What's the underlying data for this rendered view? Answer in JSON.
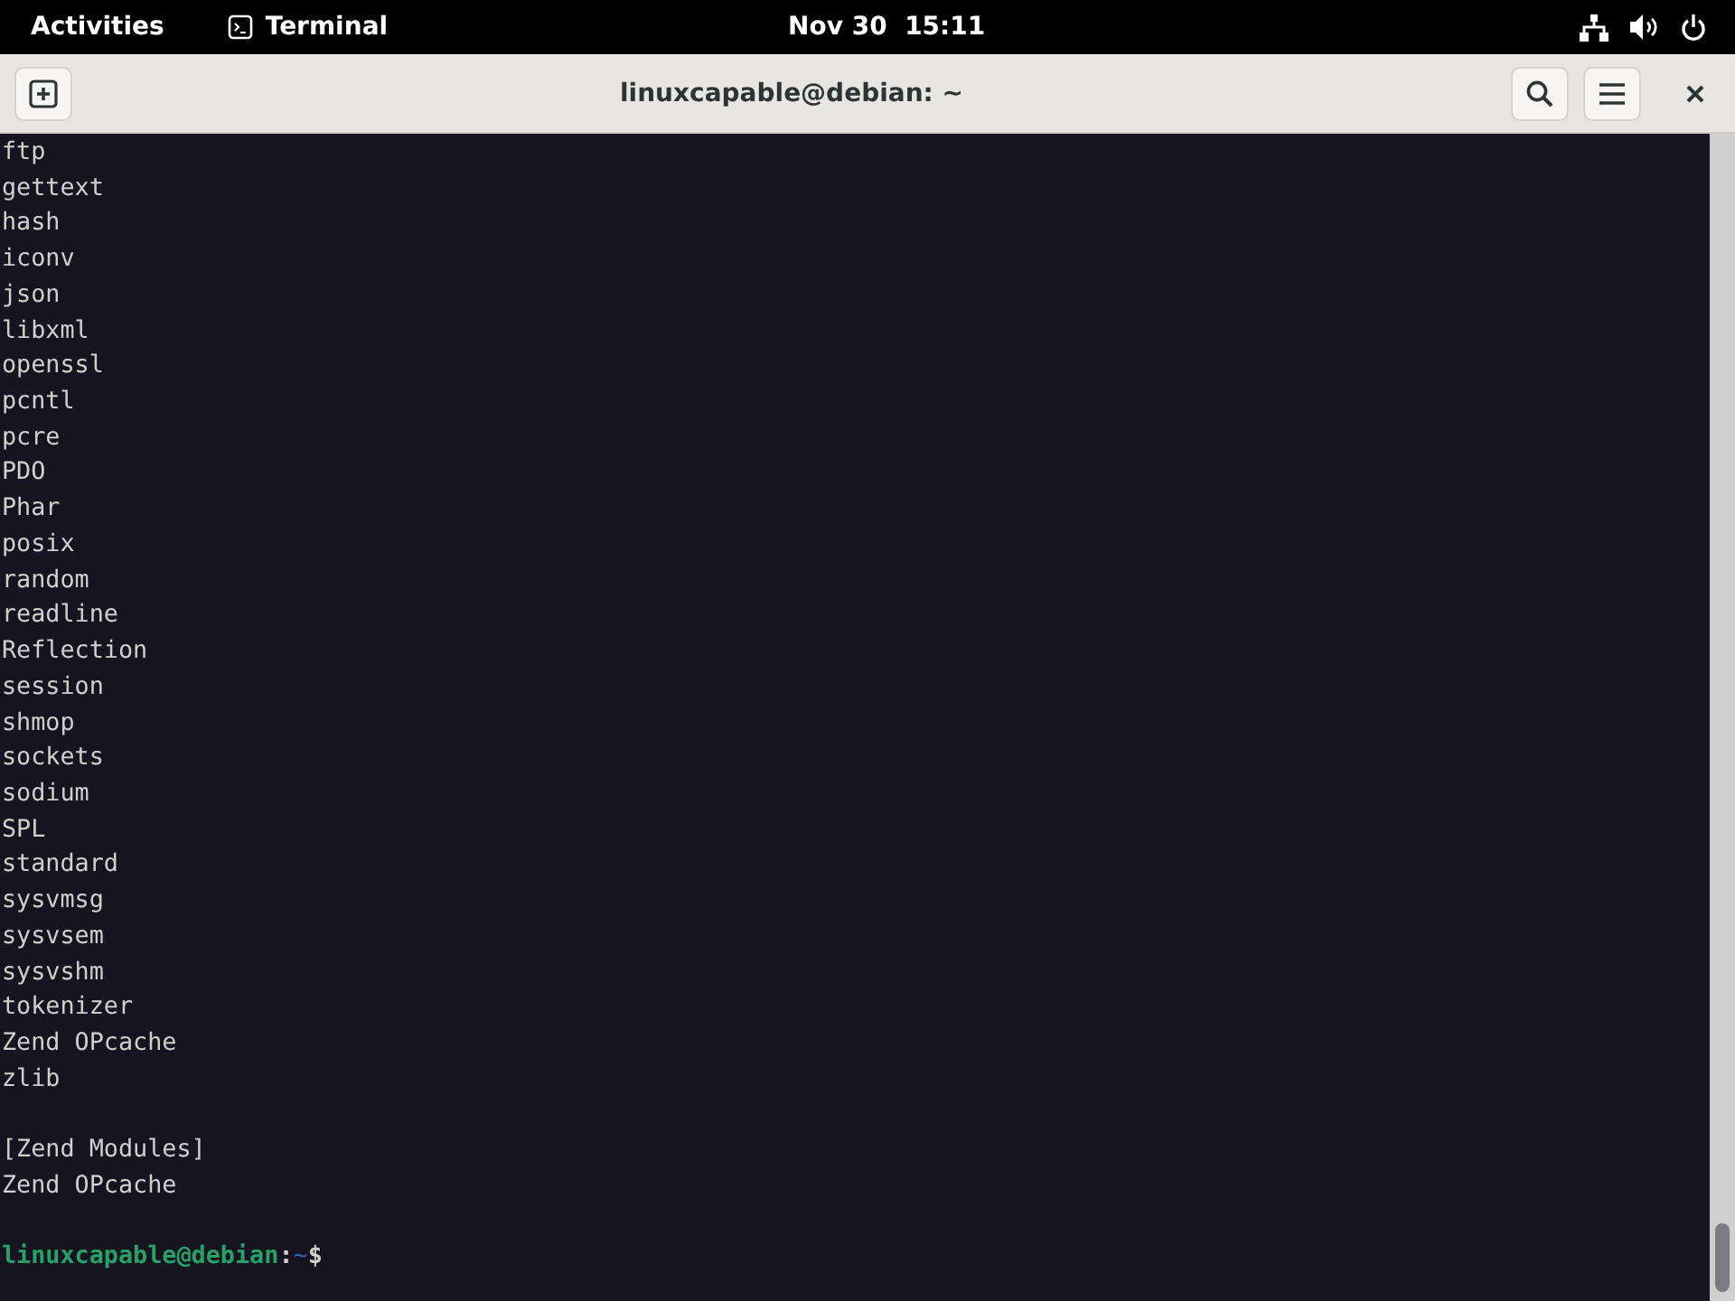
{
  "top_bar": {
    "activities": "Activities",
    "app": "Terminal",
    "clock": "Nov 30  15:11"
  },
  "window": {
    "title": "linuxcapable@debian: ~"
  },
  "terminal": {
    "lines": [
      {
        "kind": "text",
        "text": "ftp"
      },
      {
        "kind": "text",
        "text": "gettext"
      },
      {
        "kind": "text",
        "text": "hash"
      },
      {
        "kind": "text",
        "text": "iconv"
      },
      {
        "kind": "text",
        "text": "json"
      },
      {
        "kind": "text",
        "text": "libxml"
      },
      {
        "kind": "text",
        "text": "openssl"
      },
      {
        "kind": "text",
        "text": "pcntl"
      },
      {
        "kind": "text",
        "text": "pcre"
      },
      {
        "kind": "text",
        "text": "PDO"
      },
      {
        "kind": "text",
        "text": "Phar"
      },
      {
        "kind": "text",
        "text": "posix"
      },
      {
        "kind": "text",
        "text": "random"
      },
      {
        "kind": "text",
        "text": "readline"
      },
      {
        "kind": "text",
        "text": "Reflection"
      },
      {
        "kind": "text",
        "text": "session"
      },
      {
        "kind": "text",
        "text": "shmop"
      },
      {
        "kind": "text",
        "text": "sockets"
      },
      {
        "kind": "text",
        "text": "sodium"
      },
      {
        "kind": "text",
        "text": "SPL"
      },
      {
        "kind": "text",
        "text": "standard"
      },
      {
        "kind": "text",
        "text": "sysvmsg"
      },
      {
        "kind": "text",
        "text": "sysvsem"
      },
      {
        "kind": "text",
        "text": "sysvshm"
      },
      {
        "kind": "text",
        "text": "tokenizer"
      },
      {
        "kind": "text",
        "text": "Zend OPcache"
      },
      {
        "kind": "text",
        "text": "zlib"
      },
      {
        "kind": "blank"
      },
      {
        "kind": "text",
        "text": "[Zend Modules]"
      },
      {
        "kind": "text",
        "text": "Zend OPcache"
      },
      {
        "kind": "blank"
      },
      {
        "kind": "prompt",
        "user": "linuxcapable@debian",
        "sep": ":",
        "path": "~",
        "symbol": "$"
      }
    ]
  }
}
